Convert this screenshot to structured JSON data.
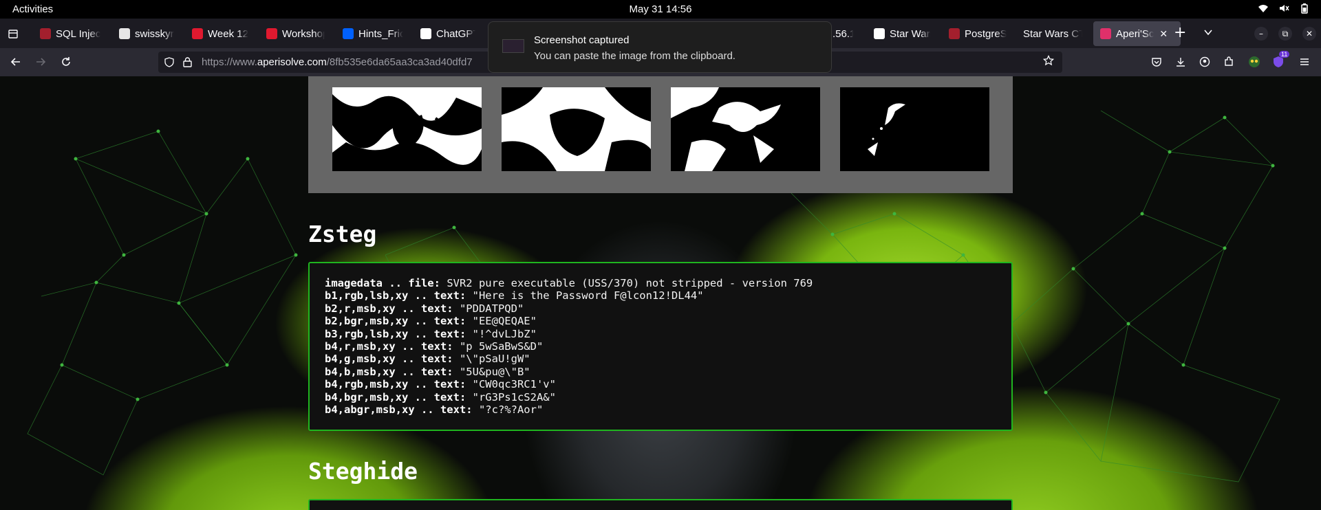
{
  "system_bar": {
    "activities": "Activities",
    "clock": "May 31  14:56"
  },
  "tabs": [
    {
      "label": "SQL Injec",
      "favicon_color": "#a31f2d"
    },
    {
      "label": "swisskyre",
      "favicon_color": "#e6e6e6"
    },
    {
      "label": "Week 12 -",
      "favicon_color": "#e0192f"
    },
    {
      "label": "Workshop",
      "favicon_color": "#e0192f"
    },
    {
      "label": "Hints_Fric",
      "favicon_color": "#0061fe"
    },
    {
      "label": "ChatGPT",
      "favicon_color": "#ffffff"
    },
    {
      "label": ".56.1(",
      "favicon_color": ""
    },
    {
      "label": "Star Wars",
      "favicon_color": "#ffffff"
    },
    {
      "label": "PostgreSC",
      "favicon_color": "#a31f2d"
    },
    {
      "label": "Star Wars CT",
      "favicon_color": ""
    },
    {
      "label": "Aperi'Sc",
      "favicon_color": "#e0306a",
      "active": true
    }
  ],
  "navbar": {
    "url_prefix": "https://www.",
    "url_domain": "aperisolve.com",
    "url_path": "/8fb535e6da65aa3ca3ad40dfd7"
  },
  "notification": {
    "title": "Screenshot captured",
    "body": "You can paste the image from the clipboard."
  },
  "sections": {
    "zsteg_title": "Zsteg",
    "steghide_title": "Steghide"
  },
  "zsteg_lines": [
    {
      "key": "imagedata .. file:",
      "value": " SVR2 pure executable (USS/370) not stripped - version 769"
    },
    {
      "key": "b1,rgb,lsb,xy .. text:",
      "value": " \"Here is the Password F@lcon12!DL44\""
    },
    {
      "key": "b2,r,msb,xy .. text:",
      "value": " \"PDDATPQD\""
    },
    {
      "key": "b2,bgr,msb,xy .. text:",
      "value": " \"EE@QEQAE\""
    },
    {
      "key": "b3,rgb,lsb,xy .. text:",
      "value": " \"!^dvLJbZ\""
    },
    {
      "key": "b4,r,msb,xy .. text:",
      "value": " \"p 5wSaBwS&D\""
    },
    {
      "key": "b4,g,msb,xy .. text:",
      "value": " \"\\\"pSaU!gW\""
    },
    {
      "key": "b4,b,msb,xy .. text:",
      "value": " \"5U&pu@\\\"B\""
    },
    {
      "key": "b4,rgb,msb,xy .. text:",
      "value": " \"CW0qc3RC1'v\""
    },
    {
      "key": "b4,bgr,msb,xy .. text:",
      "value": " \"rG3Ps1cS2A&\""
    },
    {
      "key": "b4,abgr,msb,xy .. text:",
      "value": " \"?c?%?Aor\""
    }
  ],
  "colors": {
    "accent_border": "#1fb51f",
    "panel_gray": "#666666"
  },
  "icons": {
    "notification_badge": "11"
  }
}
